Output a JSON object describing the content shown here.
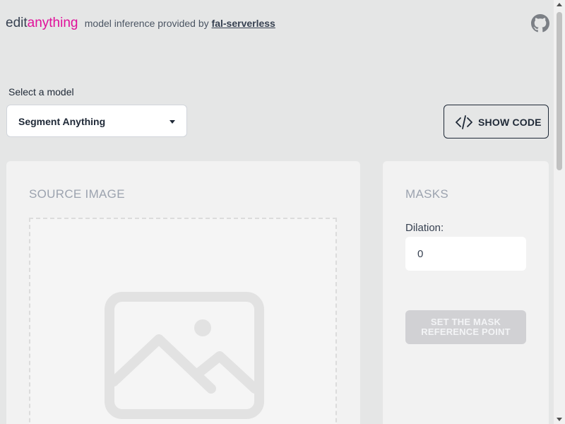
{
  "header": {
    "brand_edit": "edit",
    "brand_anything": "anything",
    "tagline": "model inference provided by",
    "provider_link": "fal-serverless",
    "github_icon": "github-icon"
  },
  "model_select": {
    "label": "Select a model",
    "value": "Segment Anything"
  },
  "show_code": {
    "label": "SHOW CODE",
    "icon": "code-icon"
  },
  "source_card": {
    "title": "SOURCE IMAGE",
    "placeholder_icon": "image-placeholder-icon"
  },
  "masks_card": {
    "title": "MASKS",
    "dilation_label": "Dilation:",
    "dilation_value": "0",
    "mask_button_label": "SET THE MASK REFERENCE POINT"
  },
  "colors": {
    "background": "#e5e6e6",
    "brand_accent": "#e0109a",
    "card": "#f2f2f2",
    "disabled_button": "#d1d1d4"
  }
}
